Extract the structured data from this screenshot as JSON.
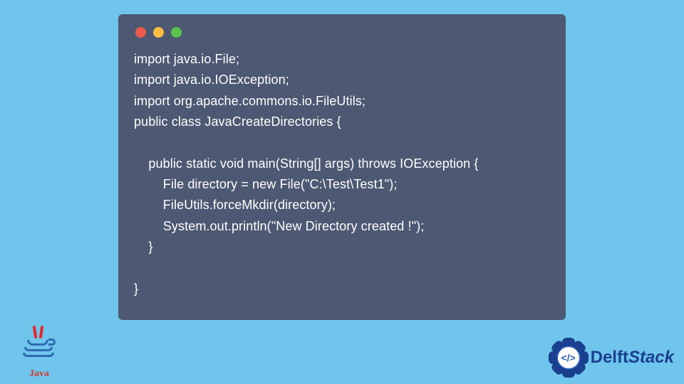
{
  "code": {
    "line1": "import java.io.File;",
    "line2": "import java.io.IOException;",
    "line3": "import org.apache.commons.io.FileUtils;",
    "line4": "public class JavaCreateDirectories {",
    "line5": "",
    "line6": "    public static void main(String[] args) throws IOException {",
    "line7": "        File directory = new File(\"C:\\Test\\Test1\");",
    "line8": "        FileUtils.forceMkdir(directory);",
    "line9": "        System.out.println(\"New Directory created !\");",
    "line10": "    }",
    "line11": "",
    "line12": "}"
  },
  "java_label": "Java",
  "delft": {
    "bold": "Delft",
    "rest": "Stack",
    "glyph": "</>"
  },
  "colors": {
    "background": "#6fc5ec",
    "window": "#4d5872",
    "dot_red": "#ed594a",
    "dot_yellow": "#fdbd41",
    "dot_green": "#5ac14c"
  }
}
